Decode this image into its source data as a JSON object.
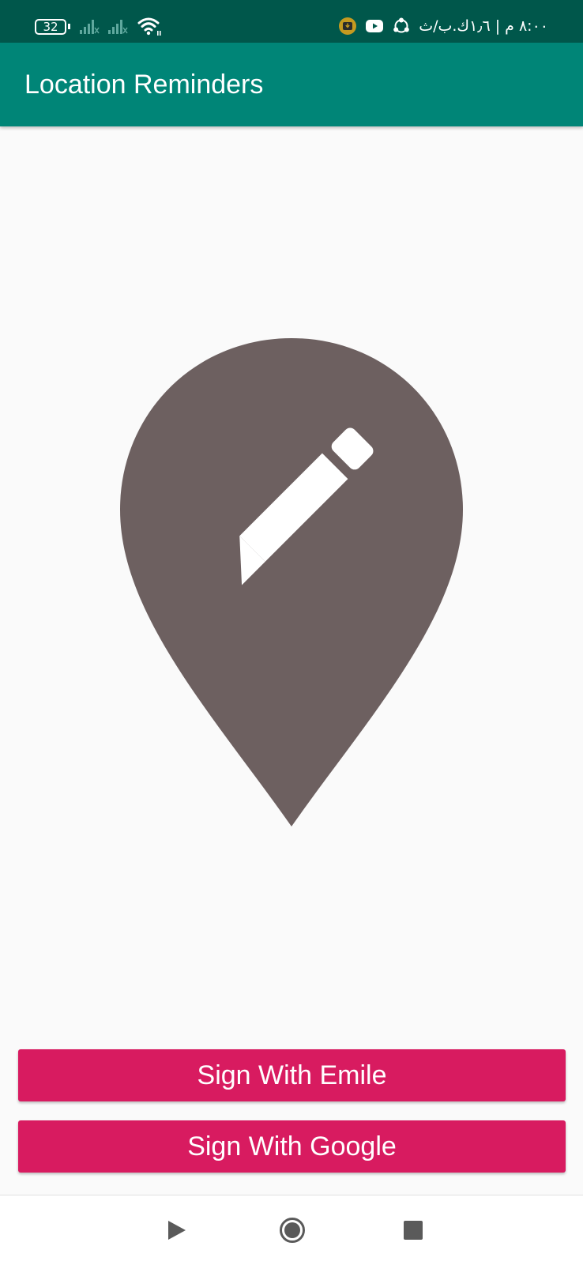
{
  "status_bar": {
    "battery_level": "32",
    "time_text": "٨:٠٠ م | ١٫٦ك.ب/ث",
    "icons": [
      "battery-icon",
      "signal-icon",
      "signal-icon",
      "wifi-icon",
      "download-notification-icon",
      "youtube-icon",
      "share-icon"
    ],
    "background": "#00574b"
  },
  "app_bar": {
    "title": "Location Reminders",
    "background": "#008577"
  },
  "hero": {
    "icon": "location-edit-icon",
    "color": "#6d6060"
  },
  "buttons": {
    "email_label": "Sign With Emile",
    "google_label": "Sign With Google",
    "color": "#d81b60"
  },
  "nav_bar": {
    "icons": [
      "back-icon",
      "home-icon",
      "recents-icon"
    ]
  }
}
